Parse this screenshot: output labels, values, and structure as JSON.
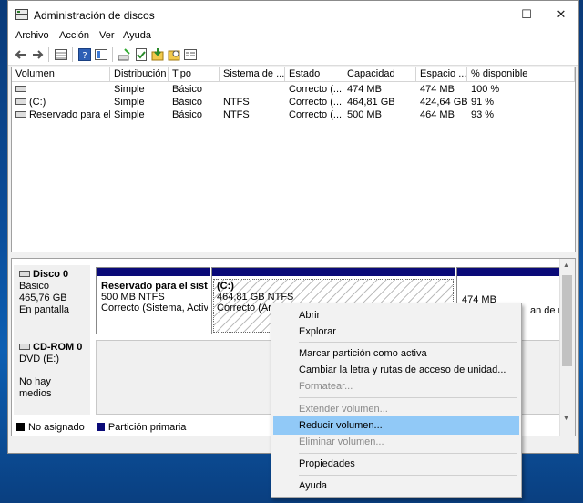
{
  "window": {
    "title": "Administración de discos",
    "controls": {
      "minimize": "—",
      "maximize": "☐",
      "close": "✕"
    }
  },
  "menu": [
    "Archivo",
    "Acción",
    "Ver",
    "Ayuda"
  ],
  "toolbar_icons": [
    "back-arrow-icon",
    "forward-arrow-icon",
    "disk-list-icon",
    "help-icon",
    "view-icon",
    "rescan-icon",
    "check-icon",
    "import-icon",
    "properties-icon",
    "settings-icon"
  ],
  "volume_list": {
    "columns": [
      "Volumen",
      "Distribución",
      "Tipo",
      "Sistema de ...",
      "Estado",
      "Capacidad",
      "Espacio ...",
      "% disponible"
    ],
    "rows": [
      [
        "",
        "Simple",
        "Básico",
        "",
        "Correcto (...",
        "474 MB",
        "474 MB",
        "100 %"
      ],
      [
        "(C:)",
        "Simple",
        "Básico",
        "NTFS",
        "Correcto (...",
        "464,81 GB",
        "424,64 GB",
        "91 %"
      ],
      [
        "Reservado para el ...",
        "Simple",
        "Básico",
        "NTFS",
        "Correcto (...",
        "500 MB",
        "464 MB",
        "93 %"
      ]
    ]
  },
  "disks": [
    {
      "name": "Disco 0",
      "type": "Básico",
      "size": "465,76 GB",
      "status": "En pantalla",
      "partitions": [
        {
          "name": "Reservado para el sistem",
          "size": "500 MB NTFS",
          "status": "Correcto (Sistema, Activo, P"
        },
        {
          "name": "(C:)",
          "size": "464,81 GB NTFS",
          "status": "Correcto (Arran"
        },
        {
          "name": "",
          "size": "474 MB",
          "status": "an de rec"
        }
      ]
    },
    {
      "name": "CD-ROM 0",
      "type": "DVD (E:)",
      "size": "",
      "status": "No hay medios"
    }
  ],
  "legend": [
    {
      "label": "No asignado",
      "color": "#000000"
    },
    {
      "label": "Partición primaria",
      "color": "#0a0a78"
    }
  ],
  "context_menu": {
    "groups": [
      [
        {
          "label": "Abrir",
          "enabled": true
        },
        {
          "label": "Explorar",
          "enabled": true
        }
      ],
      [
        {
          "label": "Marcar partición como activa",
          "enabled": true
        },
        {
          "label": "Cambiar la letra y rutas de acceso de unidad...",
          "enabled": true
        },
        {
          "label": "Formatear...",
          "enabled": false
        }
      ],
      [
        {
          "label": "Extender volumen...",
          "enabled": false
        },
        {
          "label": "Reducir volumen...",
          "enabled": true,
          "highlighted": true
        },
        {
          "label": "Eliminar volumen...",
          "enabled": false
        }
      ],
      [
        {
          "label": "Propiedades",
          "enabled": true
        }
      ],
      [
        {
          "label": "Ayuda",
          "enabled": true
        }
      ]
    ]
  },
  "colors": {
    "primary_partition": "#0a0a78",
    "menu_highlight": "#91c9f7",
    "desktop": "#0b4d9a"
  }
}
